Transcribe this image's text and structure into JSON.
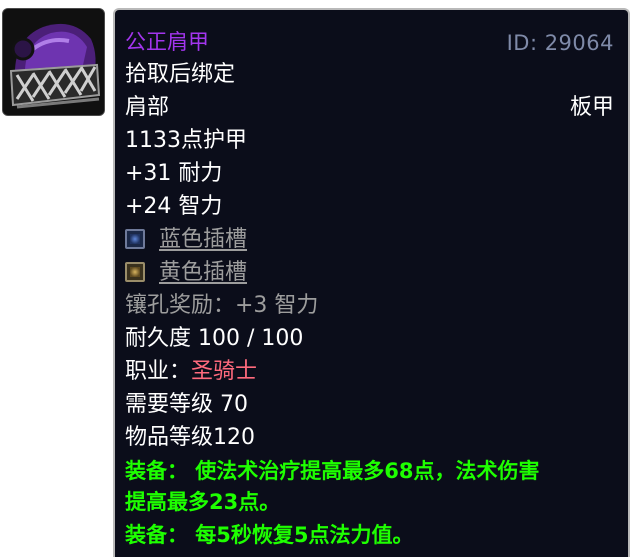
{
  "item": {
    "icon_name": "purple-shoulder-armor-icon",
    "name": "公正肩甲",
    "id_text": "ID: 29064",
    "bind": "拾取后绑定",
    "slot": "肩部",
    "armor_type": "板甲",
    "armor": "1133点护甲",
    "stats": [
      "+31 耐力",
      "+24 智力"
    ],
    "sockets": [
      {
        "color": "blue",
        "label": "蓝色插槽"
      },
      {
        "color": "yellow",
        "label": "黄色插槽"
      }
    ],
    "socket_bonus": "镶孔奖励：+3 智力",
    "durability": "耐久度 100 / 100",
    "class_prefix": "职业：",
    "class_name": "圣骑士",
    "required_level": "需要等级 70",
    "item_level": "物品等级120",
    "equip_effects": [
      "装备： 使法术治疗提高最多68点，法术伤害",
      "提高最多23点。",
      "装备： 每5秒恢复5点法力值。"
    ]
  },
  "colors": {
    "epic": "#a335ee",
    "id_text": "#7f8aa8",
    "white": "#ffffff",
    "gray": "#9d9d9d",
    "class_red": "#ff6a7d",
    "equip_green": "#1eff00",
    "background": "#0b0d1a"
  }
}
